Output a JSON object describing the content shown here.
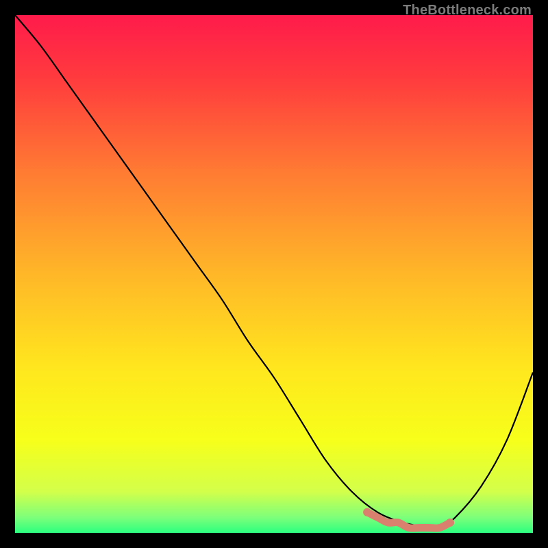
{
  "watermark": "TheBottleneck.com",
  "chart_data": {
    "type": "line",
    "title": "",
    "xlabel": "",
    "ylabel": "",
    "xlim": [
      0,
      100
    ],
    "ylim": [
      0,
      100
    ],
    "grid": false,
    "legend": false,
    "background_gradient_stops": [
      {
        "offset": 0.0,
        "color": "#ff1b4b"
      },
      {
        "offset": 0.12,
        "color": "#ff3a3e"
      },
      {
        "offset": 0.3,
        "color": "#ff7a33"
      },
      {
        "offset": 0.5,
        "color": "#ffb728"
      },
      {
        "offset": 0.68,
        "color": "#ffe61e"
      },
      {
        "offset": 0.82,
        "color": "#f7ff1a"
      },
      {
        "offset": 0.92,
        "color": "#d3ff4a"
      },
      {
        "offset": 0.97,
        "color": "#7dff7a"
      },
      {
        "offset": 1.0,
        "color": "#2bff7f"
      }
    ],
    "series": [
      {
        "name": "bottleneck-curve",
        "color": "#000000",
        "x": [
          0,
          5,
          10,
          15,
          20,
          25,
          30,
          35,
          40,
          45,
          50,
          55,
          60,
          65,
          70,
          75,
          80,
          82,
          85,
          90,
          95,
          100
        ],
        "values": [
          100,
          94,
          87,
          80,
          73,
          66,
          59,
          52,
          45,
          37,
          30,
          22,
          14,
          8,
          4,
          2,
          1,
          1,
          3,
          9,
          18,
          31
        ]
      },
      {
        "name": "optimal-zone-highlight",
        "color": "#d9806f",
        "x": [
          68,
          70,
          72,
          74,
          76,
          78,
          80,
          82,
          84
        ],
        "values": [
          4,
          3,
          2,
          2,
          1,
          1,
          1,
          1,
          2
        ]
      }
    ],
    "annotations": []
  }
}
